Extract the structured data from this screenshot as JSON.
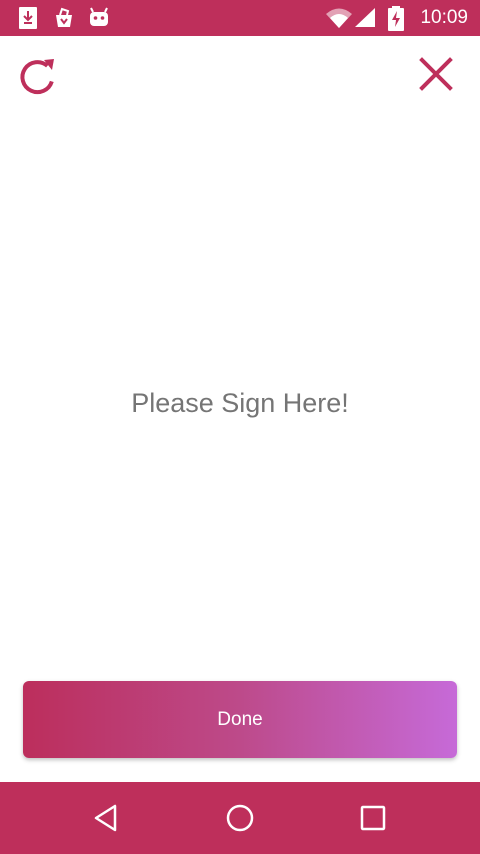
{
  "status_bar": {
    "time": "10:09",
    "icons": [
      "download-icon",
      "shop-bag-icon",
      "android-icon",
      "wifi-icon",
      "signal-icon",
      "battery-charging-icon"
    ]
  },
  "toolbar": {
    "refresh_icon": "refresh-icon",
    "close_icon": "close-icon"
  },
  "canvas": {
    "prompt": "Please Sign Here!"
  },
  "done_button": {
    "label": "Done"
  },
  "nav_bar": {
    "icons": [
      "back-triangle-icon",
      "home-circle-icon",
      "recent-square-icon"
    ]
  },
  "colors": {
    "accent": "#be2f5b",
    "gradient_start": "#bc2e5c",
    "gradient_end": "#c66ad8",
    "prompt_text": "#757575"
  }
}
